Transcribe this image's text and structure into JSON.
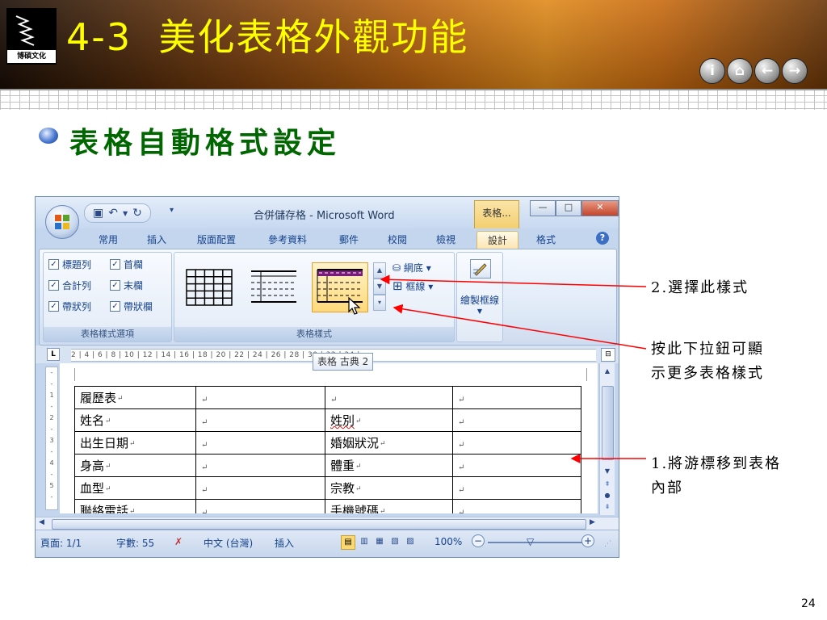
{
  "slide": {
    "logo_text": "博碩文化",
    "title_number": "4-3",
    "title_text": "美化表格外觀功能",
    "bullet": "表格自動格式設定",
    "page_number": "24",
    "nav_icons": [
      "info-icon",
      "home-icon",
      "back-arrow-icon",
      "forward-arrow-icon"
    ]
  },
  "word": {
    "window_title": "合併儲存格 - Microsoft Word",
    "context_tab": "表格...",
    "tabs": [
      "常用",
      "插入",
      "版面配置",
      "參考資料",
      "郵件",
      "校閱",
      "檢視",
      "設計",
      "格式"
    ],
    "active_tab": "設計",
    "ribbon": {
      "options": {
        "label": "表格樣式選項",
        "items": [
          "標題列",
          "首欄",
          "合計列",
          "末欄",
          "帶狀列",
          "帶狀欄"
        ]
      },
      "styles": {
        "label": "表格樣式",
        "shading": "網底",
        "borders": "框線"
      },
      "draw": {
        "label": "繪製框線"
      }
    },
    "tooltip": "表格 古典 2",
    "ruler_text": "2 | 4 | 6 | 8 | 10 | 12 | 14 | 16 | 18 | 20 | 22 | 24 | 26 | 28 | 30 | 32 | 34 |",
    "table": [
      [
        "履歷表",
        "",
        "",
        ""
      ],
      [
        "姓名",
        "",
        "姓別",
        ""
      ],
      [
        "出生日期",
        "",
        "婚姻狀況",
        ""
      ],
      [
        "身高",
        "",
        "體重",
        ""
      ],
      [
        "血型",
        "",
        "宗教",
        ""
      ],
      [
        "聯絡電話",
        "",
        "手機號碼",
        ""
      ]
    ],
    "status": {
      "page": "頁面: 1/1",
      "words": "字數: 55",
      "language": "中文 (台灣)",
      "mode": "插入",
      "zoom": "100%"
    }
  },
  "annotations": {
    "a1": "2.選擇此樣式",
    "a2_line1": "按此下拉鈕可顯",
    "a2_line2": "示更多表格樣式",
    "a3_line1": "1.將游標移到表格",
    "a3_line2": "內部"
  },
  "colors": {
    "title": "#ffff00",
    "bullet": "#006600",
    "arrow": "#ff0000",
    "header_orange": "#e08a1a"
  }
}
